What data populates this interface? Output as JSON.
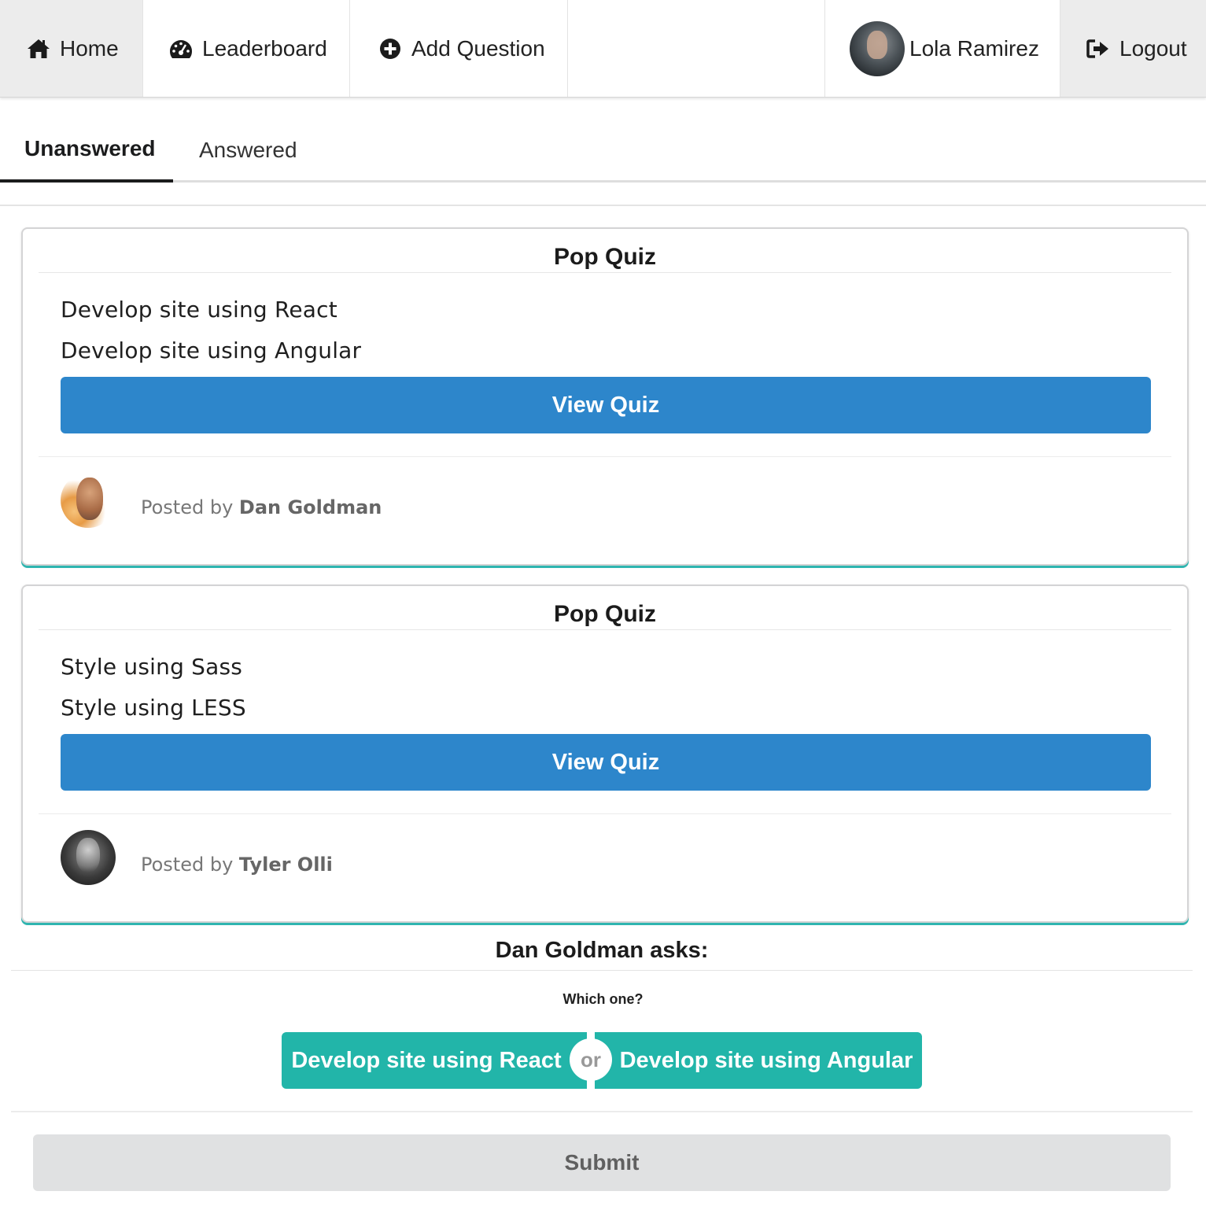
{
  "menu": {
    "home": {
      "label": "Home",
      "icon": "home-icon"
    },
    "leaderboard": {
      "label": "Leaderboard",
      "icon": "dashboard-icon"
    },
    "add_question": {
      "label": "Add Question",
      "icon": "plus-circle-icon"
    },
    "user": {
      "name": "Lola Ramirez",
      "icon": "avatar"
    },
    "logout": {
      "label": "Logout",
      "icon": "sign-out-icon"
    }
  },
  "tabs": [
    {
      "label": "Unanswered",
      "active": true
    },
    {
      "label": "Answered",
      "active": false
    }
  ],
  "cards": [
    {
      "header": "Pop Quiz",
      "option_one": "Develop site using React",
      "option_two": "Develop site using Angular",
      "button": "View Quiz",
      "posted_prefix": "Posted by",
      "author": "Dan Goldman"
    },
    {
      "header": "Pop Quiz",
      "option_one": "Style using Sass",
      "option_two": "Style using LESS",
      "button": "View Quiz",
      "posted_prefix": "Posted by",
      "author": "Tyler Olli"
    }
  ],
  "question": {
    "title": "Dan Goldman asks:",
    "prompt": "Which one?",
    "option_one": "Develop site using React",
    "or_label": "or",
    "option_two": "Develop site using Angular",
    "submit": "Submit"
  },
  "colors": {
    "primary_blue": "#2d86cb",
    "teal": "#22b5a9",
    "card_accent": "#2fb5b0",
    "submit_gray": "#e0e1e2"
  }
}
